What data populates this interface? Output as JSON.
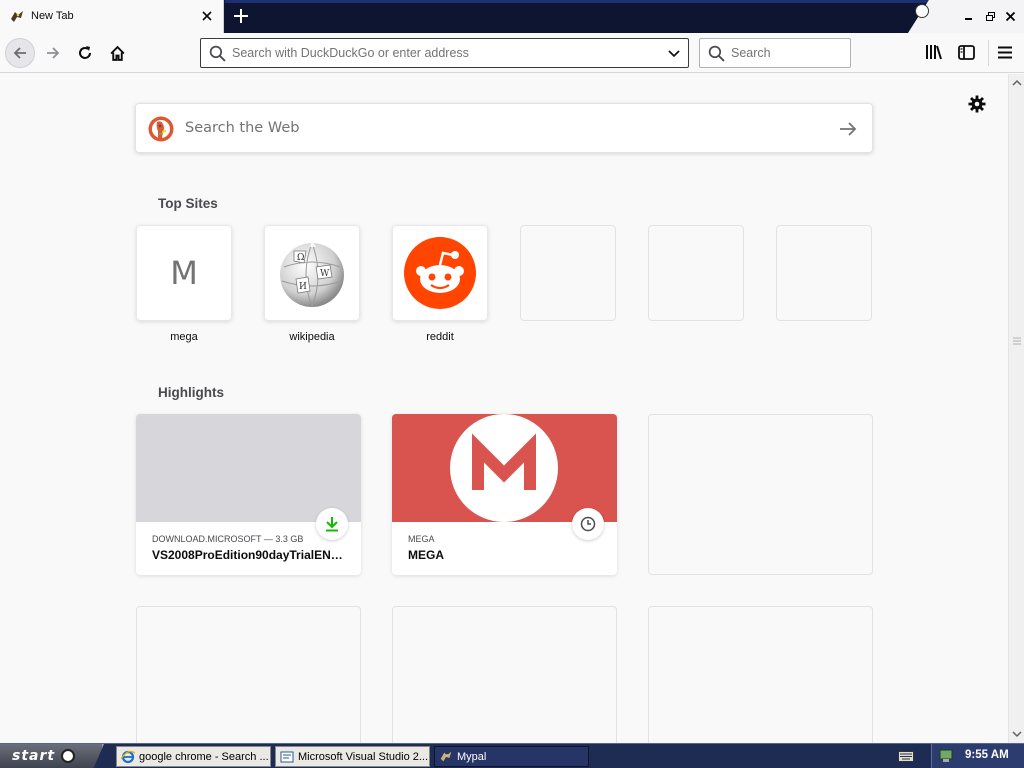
{
  "browser": {
    "tab_title": "New Tab",
    "url_placeholder": "Search with DuckDuckGo or enter address",
    "search_placeholder": "Search"
  },
  "newtab": {
    "web_search_placeholder": "Search the Web",
    "top_sites_title": "Top Sites",
    "top_sites": [
      {
        "label": "mega",
        "letter": "M",
        "icon": "letter-m-icon"
      },
      {
        "label": "wikipedia",
        "icon": "wikipedia-globe-icon"
      },
      {
        "label": "reddit",
        "icon": "reddit-alien-icon"
      },
      {
        "label": ""
      },
      {
        "label": ""
      },
      {
        "label": ""
      }
    ],
    "highlights_title": "Highlights",
    "highlights": [
      {
        "context": "DOWNLOAD.MICROSOFT — 3.3 GB",
        "title": "VS2008ProEdition90dayTrialENU...",
        "badge": "download-icon"
      },
      {
        "context": "MEGA",
        "title": "MEGA",
        "badge": "clock-icon"
      }
    ]
  },
  "taskbar": {
    "start_label": "start",
    "tasks": [
      {
        "label": "google chrome - Search ...",
        "icon": "ie-icon"
      },
      {
        "label": "Microsoft Visual Studio 2...",
        "icon": "setup-icon"
      },
      {
        "label": "Mypal",
        "icon": "mypal-icon"
      }
    ],
    "clock": "9:55 AM"
  },
  "colors": {
    "reddit": "#ff4500",
    "mega": "#d9534f",
    "download_green": "#12bc00",
    "titlebar": "#0e1530"
  }
}
